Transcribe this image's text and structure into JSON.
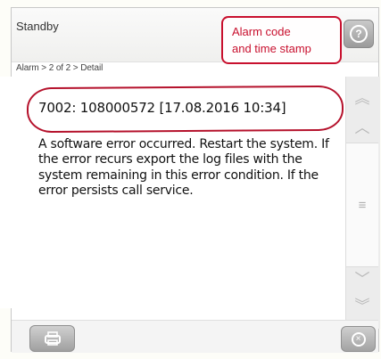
{
  "header": {
    "status": "Standby",
    "breadcrumb": "Alarm > 2 of 2 > Detail"
  },
  "callout": {
    "text": "Alarm code\nand time stamp",
    "color": "#c8102e"
  },
  "alarm": {
    "code_line": "7002: 108000572 [17.08.2016 10:34]",
    "description": "A software error occurred. Restart the system. If the error recurs export the log files with the system remaining in this error condition. If the error persists call service."
  },
  "icons": {
    "help": "question-circle-icon",
    "print": "printer-icon",
    "close": "close-circle-icon",
    "scroll_top": "double-chevron-up-icon",
    "scroll_up": "chevron-up-icon",
    "scroll_handle": "grip-lines-icon",
    "scroll_down": "chevron-down-icon",
    "scroll_bottom": "double-chevron-down-icon"
  }
}
